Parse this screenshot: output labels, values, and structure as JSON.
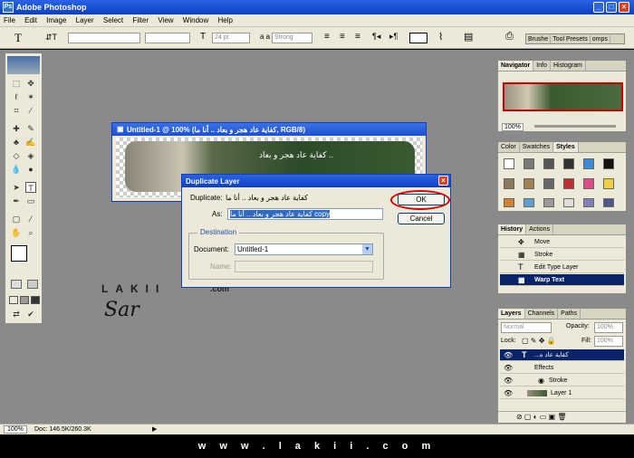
{
  "app": {
    "title": "Adobe Photoshop",
    "logo": "Ps"
  },
  "menu": [
    "File",
    "Edit",
    "Image",
    "Layer",
    "Select",
    "Filter",
    "View",
    "Window",
    "Help"
  ],
  "options": {
    "font_size": "24 pt",
    "aa_label": "a a",
    "aa_mode": "Strong",
    "tool_glyph": "T"
  },
  "palette_well": {
    "tabs": [
      "Brushe",
      "Tool Presets",
      "omps"
    ]
  },
  "document": {
    "title": "Untitled-1 @ 100% (كفاية عاد هجر و بعاد .. أنا ما, RGB/8)",
    "canvas_text": "كفاية عاد هجر و بعاد .."
  },
  "dialog": {
    "title": "Duplicate Layer",
    "duplicate_label": "Duplicate:",
    "duplicate_value": "كفاية عاد هجر و بعاد .. أنا ما",
    "as_label": "As:",
    "as_value": "كفاية عاد هجر و بعاد .. أنا ما copy",
    "ok": "OK",
    "cancel": "Cancel",
    "destination_label": "Destination",
    "document_label": "Document:",
    "document_value": "Untitled-1",
    "name_label": "Name:"
  },
  "navigator": {
    "tabs": [
      "Navigator",
      "Info",
      "Histogram"
    ],
    "zoom": "100%"
  },
  "swatches": {
    "tabs": [
      "Color",
      "Swatches",
      "Styles"
    ]
  },
  "history": {
    "tabs": [
      "History",
      "Actions"
    ],
    "items": [
      {
        "label": "Move",
        "selected": false
      },
      {
        "label": "Stroke",
        "selected": false
      },
      {
        "label": "Edit Type Layer",
        "selected": false
      },
      {
        "label": "Warp Text",
        "selected": true
      }
    ]
  },
  "layers": {
    "tabs": [
      "Layers",
      "Channels",
      "Paths"
    ],
    "blend_mode": "Normal",
    "opacity_label": "Opacity:",
    "opacity": "100%",
    "lock_label": "Lock:",
    "fill_label": "Fill:",
    "fill": "100%",
    "items": [
      {
        "label": "...كفاية عاد ه",
        "selected": true
      },
      {
        "label": "Effects",
        "selected": false
      },
      {
        "label": "Stroke",
        "selected": false
      },
      {
        "label": "Layer 1",
        "selected": false
      }
    ]
  },
  "status": {
    "zoom": "100%",
    "doc": "Doc: 146.5K/260.3K"
  },
  "watermark": {
    "brand": "LAKII",
    "domain": ".com",
    "signature": "Sar"
  },
  "footer": {
    "text": "w w w . l a k i i . c o m"
  },
  "colors": {
    "title_blue": "#0b3fc4",
    "workspace_gray": "#8a8a8a",
    "highlight": "#d40000"
  }
}
